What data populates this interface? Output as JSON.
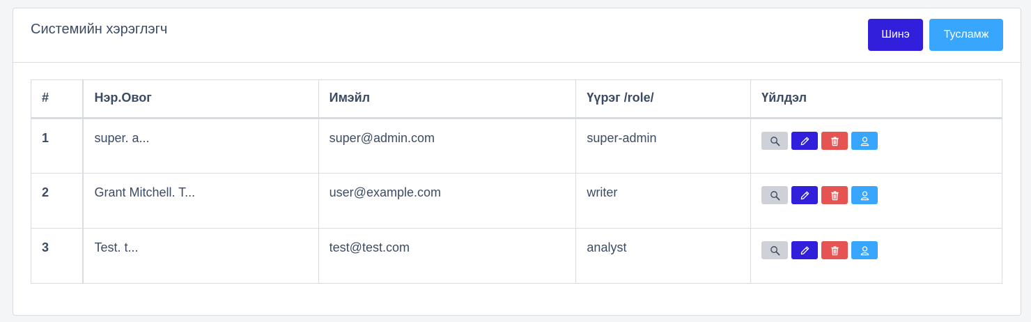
{
  "header": {
    "title": "Системийн хэрэглэгч",
    "new_label": "Шинэ",
    "help_label": "Тусламж"
  },
  "table": {
    "columns": [
      "#",
      "Нэр.Овог",
      "Имэйл",
      "Үүрэг /role/",
      "Үйлдэл"
    ],
    "rows": [
      {
        "num": "1",
        "name": "super. a...",
        "email": "super@admin.com",
        "role": "super-admin"
      },
      {
        "num": "2",
        "name": "Grant Mitchell. T...",
        "email": "user@example.com",
        "role": "writer"
      },
      {
        "num": "3",
        "name": "Test. t...",
        "email": "test@test.com",
        "role": "analyst"
      }
    ],
    "row_actions": [
      "search-icon",
      "pencil-icon",
      "trash-icon",
      "user-icon"
    ]
  },
  "colors": {
    "primary": "#321fdb",
    "info": "#39a6fd",
    "danger": "#e55353",
    "secondary": "#ced2d8"
  }
}
